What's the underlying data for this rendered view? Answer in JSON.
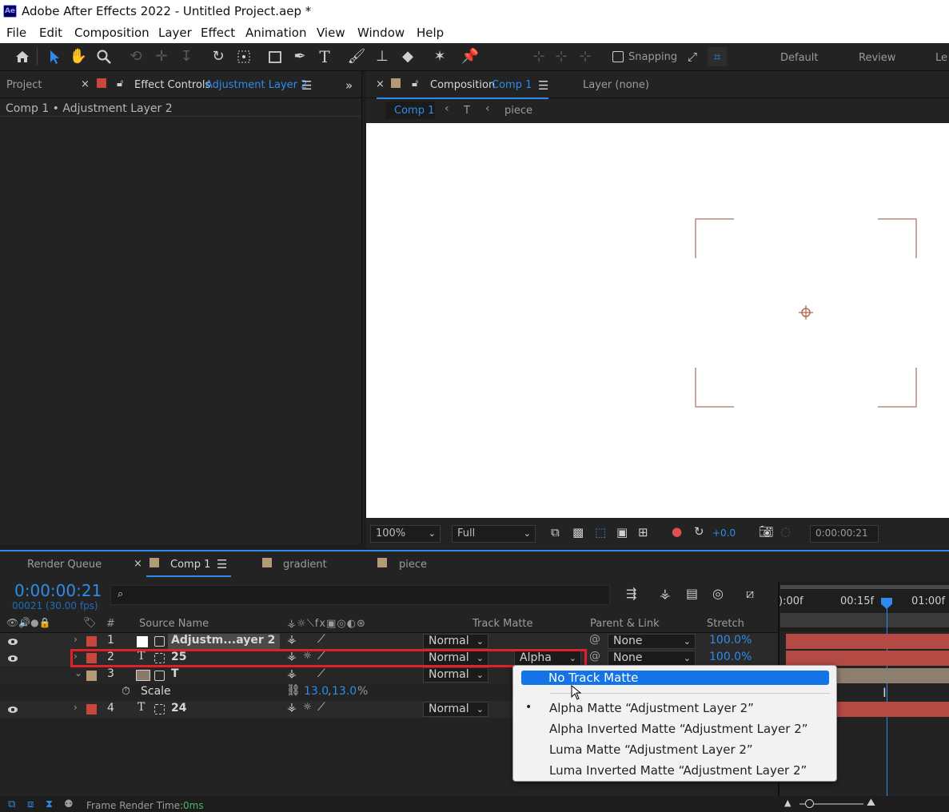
{
  "window": {
    "app_badge": "Ae",
    "title": "Adobe After Effects 2022 - Untitled Project.aep *"
  },
  "menu": [
    "File",
    "Edit",
    "Composition",
    "Layer",
    "Effect",
    "Animation",
    "View",
    "Window",
    "Help"
  ],
  "toolbar": {
    "snapping_label": "Snapping",
    "workspaces": [
      "Default",
      "Review",
      "Le"
    ]
  },
  "left_panel": {
    "project_tab": "Project",
    "effect_controls_tab": "Effect Controls",
    "effect_controls_target": "Adjustment Layer 2",
    "subheader": "Comp 1 • Adjustment Layer 2"
  },
  "comp_panel": {
    "composition_tab": "Composition",
    "composition_name": "Comp 1",
    "layer_tab": "Layer (none)",
    "breadcrumbs": [
      "Comp 1",
      "T",
      "piece"
    ],
    "zoom": "100%",
    "resolution": "Full",
    "exposure": "+0.0",
    "timecode": "0:00:00:21"
  },
  "timeline": {
    "tabs": [
      "Render Queue",
      "Comp 1",
      "gradient",
      "piece"
    ],
    "current_time": "0:00:00:21",
    "frame_info": "00021 (30.00 fps)",
    "search_placeholder": "",
    "ruler": [
      "):00f",
      "00:15f",
      "01:00f"
    ],
    "columns": {
      "num": "#",
      "source": "Source Name",
      "track_matte": "Track Matte",
      "parent": "Parent & Link",
      "stretch": "Stretch"
    },
    "layers": [
      {
        "num": "1",
        "type_icon": "",
        "name": "Adjustm...ayer 2",
        "mode": "Normal",
        "matte": "",
        "parent": "None",
        "stretch": "100.0%",
        "color": "#c9473a"
      },
      {
        "num": "2",
        "type_icon": "T",
        "name": "25",
        "mode": "Normal",
        "matte": "Alpha",
        "parent": "None",
        "stretch": "100.0%",
        "color": "#c9473a"
      },
      {
        "num": "3",
        "type_icon": "",
        "name": "T",
        "mode": "Normal",
        "matte": "",
        "parent": "",
        "stretch": "",
        "color": "#b59a78"
      },
      {
        "num": "4",
        "type_icon": "T",
        "name": "24",
        "mode": "Normal",
        "matte": "",
        "parent": "",
        "stretch": "",
        "color": "#c9473a"
      }
    ],
    "scale_property": {
      "label": "Scale",
      "value_x": "13.0",
      "value_y": "13.0",
      "unit": "%"
    }
  },
  "matte_menu": {
    "items": [
      "No Track Matte",
      "Alpha Matte “Adjustment Layer 2”",
      "Alpha Inverted Matte “Adjustment Layer 2”",
      "Luma Matte “Adjustment Layer 2”",
      "Luma Inverted Matte “Adjustment Layer 2”"
    ],
    "highlighted_index": 0,
    "checked_index": 1
  },
  "status": {
    "frame_render_label": "Frame Render Time:",
    "frame_render_value": "0ms"
  },
  "colors": {
    "accent": "#2d8ceb",
    "highlight": "#1473e6",
    "label_red": "#c9473a",
    "label_tan": "#b59a78",
    "selection_box": "#e0202a"
  }
}
